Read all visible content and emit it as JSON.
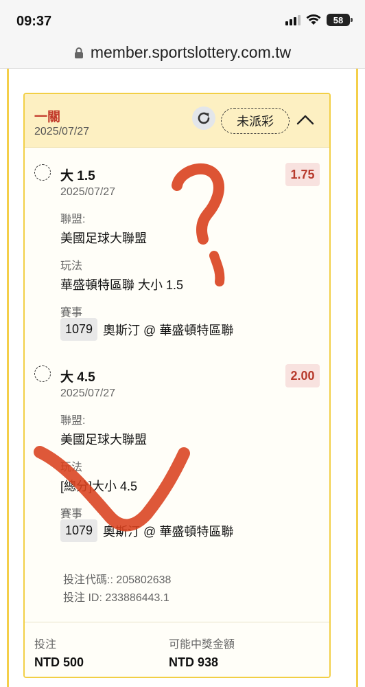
{
  "status_bar": {
    "time": "09:37",
    "battery": "58"
  },
  "browser": {
    "url": "member.sportslottery.com.tw"
  },
  "ticket": {
    "title": "一關",
    "date": "2025/07/27",
    "status": "未派彩",
    "bets": [
      {
        "selection": "大 1.5",
        "odds": "1.75",
        "date": "2025/07/27",
        "league_label": "聯盟:",
        "league": "美國足球大聯盟",
        "market_label": "玩法",
        "market": "華盛頓特區聯 大小 1.5",
        "event_label": "賽事",
        "event_code": "1079",
        "event": "奧斯汀 @ 華盛頓特區聯"
      },
      {
        "selection": "大 4.5",
        "odds": "2.00",
        "date": "2025/07/27",
        "league_label": "聯盟:",
        "league": "美國足球大聯盟",
        "market_label": "玩法",
        "market": "[總分]大小 4.5",
        "event_label": "賽事",
        "event_code": "1079",
        "event": "奧斯汀 @ 華盛頓特區聯"
      }
    ],
    "bet_code": "投注代碼:: 205802638",
    "bet_id": "投注 ID: 233886443.1",
    "stake_label": "投注",
    "stake": "NTD 500",
    "payout_label": "可能中獎金額",
    "payout": "NTD 938"
  },
  "annotations": {
    "color": "#d9411e"
  },
  "colors": {
    "accent": "#f2cf45",
    "header_bg": "#fdf0c2",
    "odds_text": "#b73a2c",
    "title_red": "#c23a2b"
  }
}
